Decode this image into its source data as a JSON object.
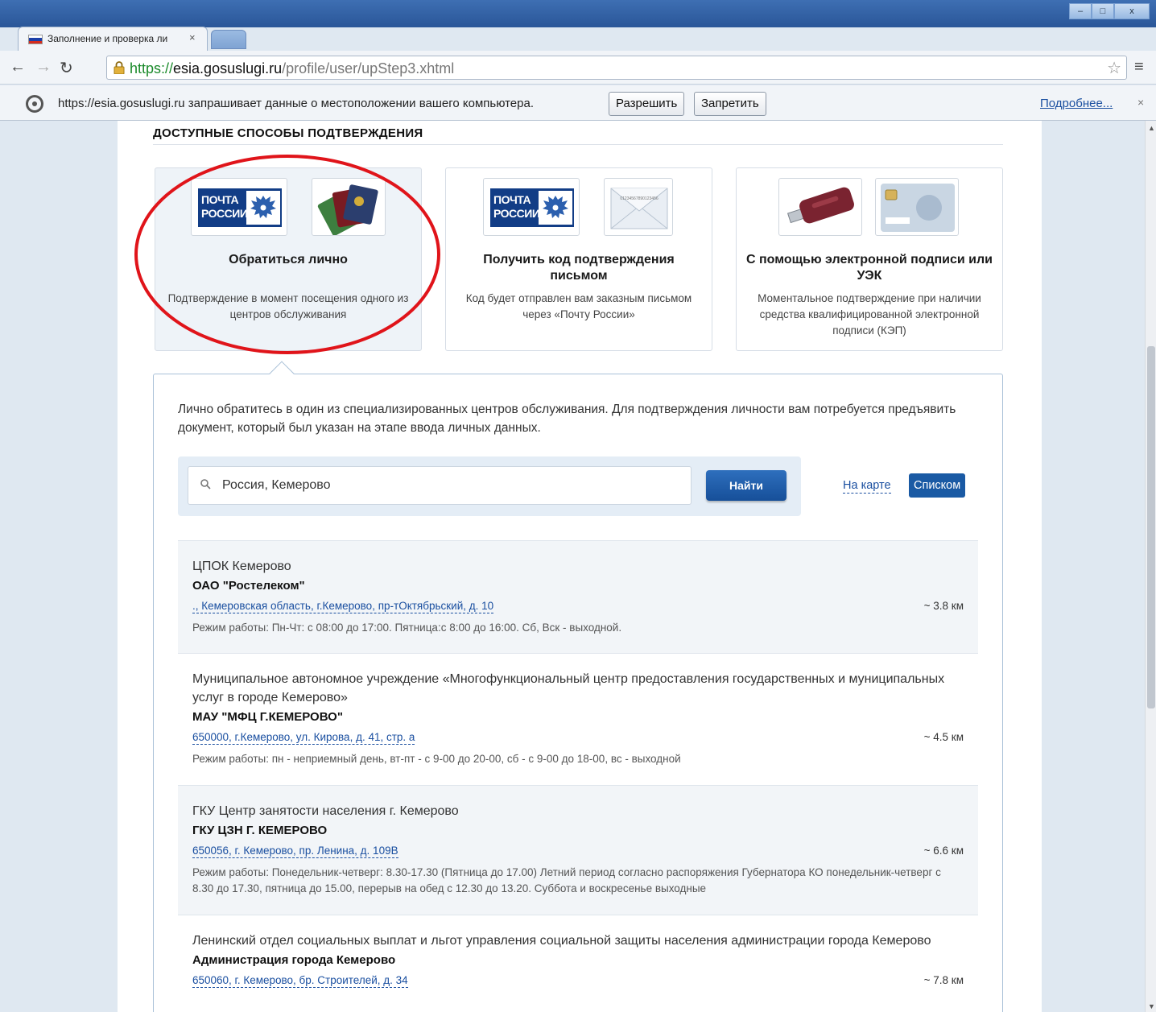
{
  "browser": {
    "tab_title": "Заполнение и проверка ли",
    "tab_close": "×",
    "url_scheme": "https://",
    "url_host": "esia.gosuslugi.ru",
    "url_path": "/profile/user/upStep3.xhtml",
    "window_minimize": "–",
    "window_maximize": "□",
    "window_close": "x"
  },
  "infobar": {
    "message": "https://esia.gosuslugi.ru запрашивает данные о местоположении вашего компьютера.",
    "allow_label": "Разрешить",
    "deny_label": "Запретить",
    "more_label": "Подробнее...",
    "close": "×"
  },
  "section": {
    "title": "ДОСТУПНЫЕ СПОСОБЫ ПОДТВЕРЖДЕНИЯ"
  },
  "cards": [
    {
      "logo_text": "ПОЧТА РОССИИ",
      "title": "Обратиться лично",
      "description": "Подтверждение в момент посещения одного из центров обслуживания"
    },
    {
      "logo_text": "ПОЧТА РОССИИ",
      "envelope_code": "01234567890123456",
      "title": "Получить код подтверждения письмом",
      "description": "Код будет отправлен вам заказным письмом через «Почту России»"
    },
    {
      "title": "С помощью электронной подписи или УЭК",
      "description": "Моментальное подтверждение при наличии средства квалифицированной электронной подписи (КЭП)"
    }
  ],
  "panel": {
    "intro": "Лично обратитесь в один из специализированных центров обслуживания. Для подтверждения личности вам потребуется предъявить документ, который был указан на этапе ввода личных данных.",
    "search_value": "Россия, Кемерово",
    "find_label": "Найти",
    "map_label": "На карте",
    "list_label": "Списком"
  },
  "results": [
    {
      "title": "ЦПОК Кемерово",
      "org": "ОАО \"Ростелеком\"",
      "address": "., Кемеровская область, г.Кемерово, пр-тОктябрьский, д. 10",
      "distance": "~ 3.8 км",
      "hours": "Режим работы: Пн-Чт: с 08:00 до 17:00. Пятница:с 8:00 до 16:00. Сб, Вск - выходной."
    },
    {
      "title": "Муниципальное автономное учреждение «Многофункциональный центр предоставления государственных и муниципальных услуг в городе Кемерово»",
      "org": "МАУ \"МФЦ Г.КЕМЕРОВО\"",
      "address": "650000, г.Кемерово, ул. Кирова, д. 41, стр. а",
      "distance": "~ 4.5 км",
      "hours": "Режим работы: пн - неприемный день, вт-пт - с 9-00 до 20-00, сб - с 9-00 до 18-00, вс - выходной"
    },
    {
      "title": "ГКУ Центр занятости населения г. Кемерово",
      "org": "ГКУ ЦЗН Г. КЕМЕРОВО",
      "address": "650056, г. Кемерово, пр. Ленина, д. 109В",
      "distance": "~ 6.6 км",
      "hours": "Режим работы: Понедельник-четверг: 8.30-17.30 (Пятница до 17.00) Летний период согласно распоряжения Губернатора КО понедельник-четверг с 8.30 до 17.30, пятница до 15.00, перерыв на обед с 12.30 до 13.20. Суббота и воскресенье выходные"
    },
    {
      "title": "Ленинский отдел социальных выплат и льгот управления социальной защиты населения администрации города Кемерово",
      "org": "Администрация города Кемерово",
      "address": "650060, г. Кемерово, бр. Строителей, д. 34",
      "distance": "~ 7.8 км",
      "hours": ""
    }
  ],
  "colors": {
    "accent": "#1a5aa4",
    "link": "#1a4fa0",
    "annotation": "#e0141a"
  }
}
